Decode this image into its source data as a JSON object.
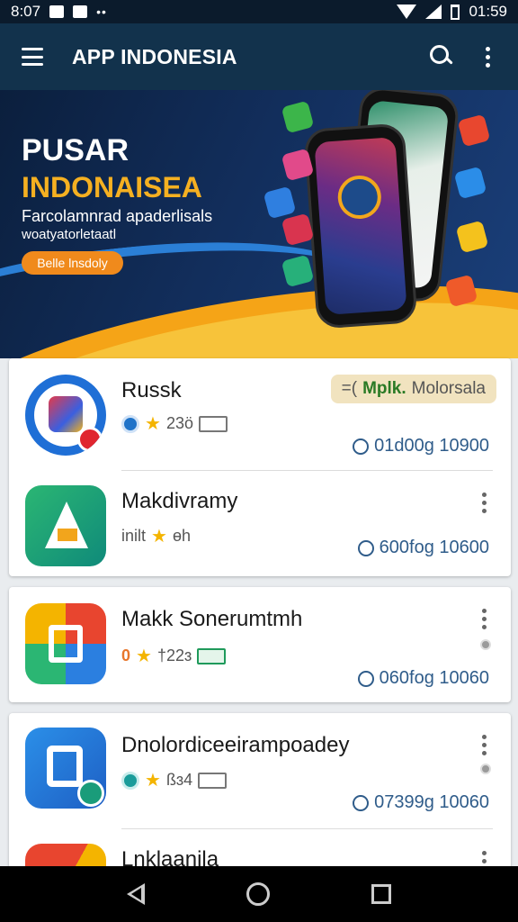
{
  "status_bar": {
    "time": "8:07",
    "right_time": "01:59"
  },
  "app_bar": {
    "title": "APP INDONESIA",
    "icons": [
      "menu-icon",
      "search-icon",
      "more-vert-icon"
    ]
  },
  "banner": {
    "title_line1": "PUSAR",
    "title_line2": "INDONAISEA",
    "subtitle_line1": "Farcolamnrad apaderlisals",
    "subtitle_line2": "woatyatorletaatl",
    "button_label": "Belle lnsdoly",
    "colors": {
      "accent": "#f5a417",
      "highlight": "#f5b021",
      "background": "#122e5c"
    }
  },
  "apps": [
    {
      "name": "Russk",
      "rating": "23ö",
      "tag_text": "Mplk.",
      "tag_suffix": "Molorsala",
      "tag_prefix": "=(",
      "downloads": "01d00g 10900"
    },
    {
      "name": "Makdivramy",
      "info": "inilt",
      "rating": "ɵh",
      "downloads": "600fog 10600"
    },
    {
      "name": "Makk Sonerumtmh",
      "rating_prefix": "0",
      "rating": "†22ɜ",
      "downloads": "060fog 10060"
    },
    {
      "name": "Dnolordiceeirampoadey",
      "rating": "ßɜ4",
      "downloads": "07399g 10060"
    },
    {
      "name": "Lnklaanila"
    }
  ],
  "nav_bar": {
    "icons": [
      "back-icon",
      "home-icon",
      "recents-icon"
    ]
  }
}
